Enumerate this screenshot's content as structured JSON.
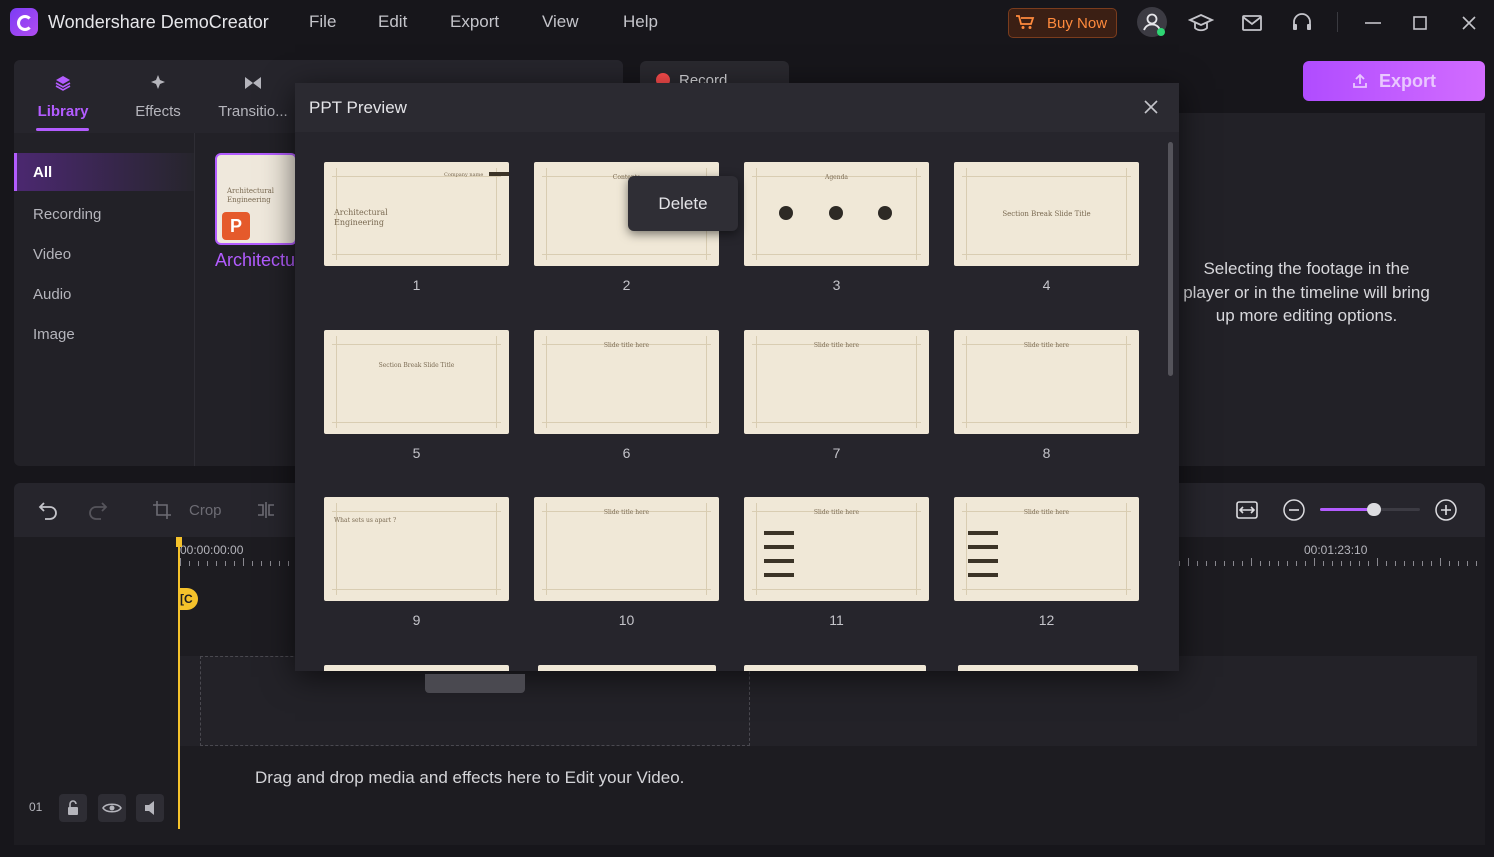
{
  "app": {
    "title": "Wondershare DemoCreator",
    "menu": [
      "File",
      "Edit",
      "Export",
      "View",
      "Help"
    ],
    "buy_label": "Buy Now",
    "export_label": "Export",
    "accent": "#b35cff",
    "buy_color": "#ff8a3d"
  },
  "tabs": [
    {
      "label": "Library",
      "icon": "library-icon"
    },
    {
      "label": "Effects",
      "icon": "effects-icon"
    },
    {
      "label": "Transitio...",
      "icon": "transitions-icon"
    }
  ],
  "record": {
    "label": "Record"
  },
  "sidebar": {
    "items": [
      {
        "label": "All"
      },
      {
        "label": "Recording"
      },
      {
        "label": "Video"
      },
      {
        "label": "Audio"
      },
      {
        "label": "Image"
      }
    ]
  },
  "library": {
    "thumb_name": "Architectu",
    "badge": "P",
    "thumb_title": "Architectural Engineering"
  },
  "preview": {
    "hint": "Selecting the footage in the player or in the timeline will bring up more editing options."
  },
  "modal": {
    "title": "PPT Preview",
    "delete_label": "Delete",
    "slides": [
      {
        "num": "1",
        "text": "Architectural Engineering",
        "header": "Company name"
      },
      {
        "num": "2",
        "text": "Contents"
      },
      {
        "num": "3",
        "text": "Agenda"
      },
      {
        "num": "4",
        "text": "Section Break Slide Title"
      },
      {
        "num": "5",
        "text": "Section Break Slide Title"
      },
      {
        "num": "6",
        "text": "Slide title here"
      },
      {
        "num": "7",
        "text": "Slide title here"
      },
      {
        "num": "8",
        "text": "Slide title here"
      },
      {
        "num": "9",
        "text": "What sets us apart ?"
      },
      {
        "num": "10",
        "text": "Slide title here"
      },
      {
        "num": "11",
        "text": "Slide title here"
      },
      {
        "num": "12",
        "text": "Slide title here"
      }
    ]
  },
  "timeline": {
    "crop_label": "Crop",
    "start_time": "00:00:00:00",
    "end_time": "00:01:23:10",
    "drop_text": "Drag and drop media and effects here to Edit your Video.",
    "track_number": "01",
    "playhead_color": "#f5c22b",
    "zoom_level": 0.54
  }
}
